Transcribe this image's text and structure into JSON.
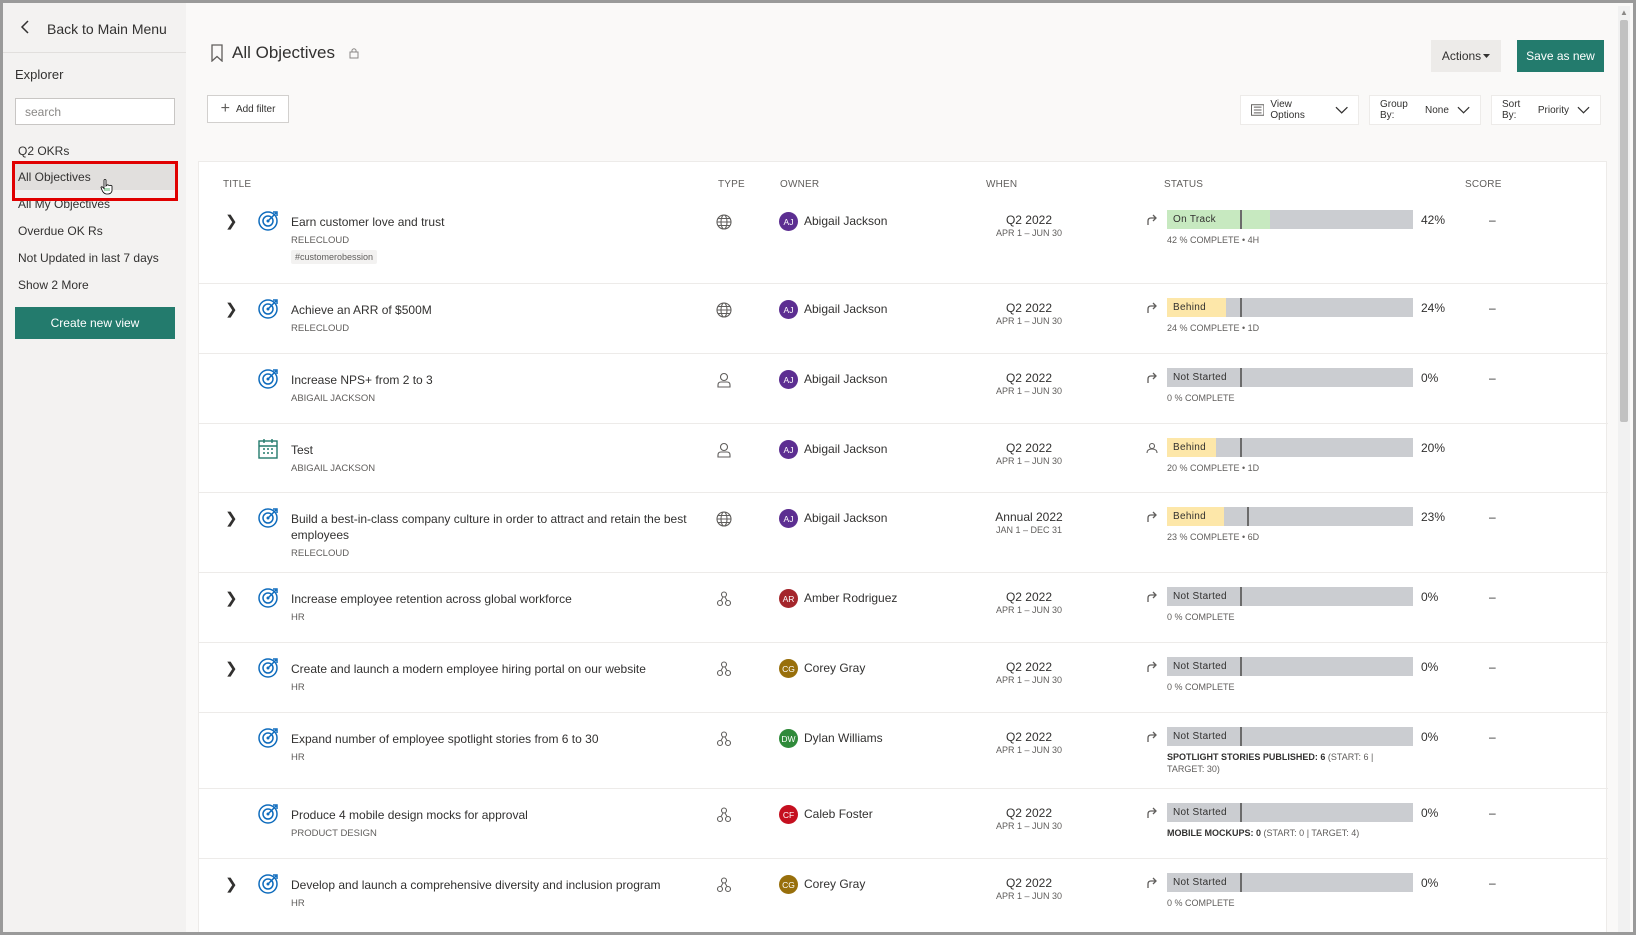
{
  "sidebar": {
    "back_label": "Back to Main Menu",
    "explorer_label": "Explorer",
    "search_placeholder": "search",
    "items": [
      {
        "label": "Q2 OKRs"
      },
      {
        "label": "All Objectives"
      },
      {
        "label": "All My Objectives"
      },
      {
        "label": "Overdue OK Rs"
      },
      {
        "label": "Not Updated in last 7 days"
      },
      {
        "label": "Show 2 More"
      }
    ],
    "create_label": "Create new view"
  },
  "header": {
    "title": "All Objectives",
    "actions_label": "Actions",
    "save_label": "Save as new",
    "add_filter_label": "Add filter",
    "view_options_label": "View Options",
    "group_by_label": "Group By:",
    "group_by_value": "None",
    "sort_by_label": "Sort By:",
    "sort_by_value": "Priority"
  },
  "table": {
    "columns": {
      "title": "TITLE",
      "type": "TYPE",
      "owner": "OWNER",
      "when": "WHEN",
      "status": "STATUS",
      "score": "SCORE"
    },
    "rows": [
      {
        "title": "Earn customer love and trust",
        "sub": "RELECLOUD",
        "tag": "#customerobession",
        "owner": "Abigail Jackson",
        "initials": "AJ",
        "when": "Q2 2022",
        "range": "APR 1 – JUN 30",
        "status": "On Track",
        "progress": 0.42,
        "pct": "42%",
        "note": "42 % COMPLETE • 4H",
        "score": "–"
      },
      {
        "title": "Achieve an ARR of $500M",
        "sub": "RELECLOUD",
        "owner": "Abigail Jackson",
        "initials": "AJ",
        "when": "Q2 2022",
        "range": "APR 1 – JUN 30",
        "status": "Behind",
        "progress": 0.24,
        "pct": "24%",
        "note": "24 % COMPLETE • 1D",
        "score": "–"
      },
      {
        "title": "Increase NPS+ from 2 to 3",
        "sub": "ABIGAIL JACKSON",
        "owner": "Abigail Jackson",
        "initials": "AJ",
        "when": "Q2 2022",
        "range": "APR 1 – JUN 30",
        "status": "Not Started",
        "progress": 0,
        "pct": "0%",
        "note": "0 % COMPLETE",
        "score": "–"
      },
      {
        "title": "Test",
        "sub": "ABIGAIL JACKSON",
        "owner": "Abigail Jackson",
        "initials": "AJ",
        "when": "Q2 2022",
        "range": "APR 1 – JUN 30",
        "status": "Behind",
        "progress": 0.2,
        "pct": "20%",
        "note": "20 % COMPLETE • 1D",
        "score": ""
      },
      {
        "title_line1": "Build a best-in-class company culture in order to attract and retain the best",
        "title_line2": "employees",
        "sub": "RELECLOUD",
        "owner": "Abigail Jackson",
        "initials": "AJ",
        "when": "Annual 2022",
        "range": "JAN 1 – DEC 31",
        "status": "Behind",
        "progress": 0.23,
        "pct": "23%",
        "note": "23 % COMPLETE • 6D",
        "score": "–"
      },
      {
        "title": "Increase employee retention across global workforce",
        "sub": "HR",
        "owner": "Amber Rodriguez",
        "initials": "AR",
        "when": "Q2 2022",
        "range": "APR 1 – JUN 30",
        "status": "Not Started",
        "progress": 0,
        "pct": "0%",
        "note": "0 % COMPLETE",
        "score": "–"
      },
      {
        "title": "Create and launch a modern employee hiring portal on our website",
        "sub": "HR",
        "owner": "Corey Gray",
        "initials": "CG",
        "when": "Q2 2022",
        "range": "APR 1 – JUN 30",
        "status": "Not Started",
        "progress": 0,
        "pct": "0%",
        "note": "0 % COMPLETE",
        "score": "–"
      },
      {
        "title": "Expand number of employee spotlight stories from 6 to 30",
        "sub": "HR",
        "owner": "Dylan Williams",
        "initials": "DW",
        "when": "Q2 2022",
        "range": "APR 1 – JUN 30",
        "status": "Not Started",
        "progress": 0,
        "pct": "0%",
        "metric_bold": "SPOTLIGHT STORIES PUBLISHED: 6",
        "metric_rest": " (START: 6 |",
        "metric_line2": "TARGET: 30)",
        "score": "–"
      },
      {
        "title": "Produce 4 mobile design mocks for approval",
        "sub": "PRODUCT DESIGN",
        "owner": "Caleb Foster",
        "initials": "CF",
        "when": "Q2 2022",
        "range": "APR 1 – JUN 30",
        "status": "Not Started",
        "progress": 0,
        "pct": "0%",
        "metric_bold": "MOBILE MOCKUPS: 0",
        "metric_rest": " (START: 0 | TARGET: 4)",
        "score": "–"
      },
      {
        "title": "Develop and launch a comprehensive diversity and inclusion program",
        "sub": "HR",
        "owner": "Corey Gray",
        "initials": "CG",
        "when": "Q2 2022",
        "range": "APR 1 – JUN 30",
        "status": "Not Started",
        "progress": 0,
        "pct": "0%",
        "note": "0 % COMPLETE",
        "score": "–"
      }
    ]
  },
  "colors": {
    "accent": "#237b6d",
    "on_track": "#c7e9c0",
    "behind": "#fde7a9",
    "not_started": "#cbcdd1",
    "highlight": "#e00000"
  }
}
